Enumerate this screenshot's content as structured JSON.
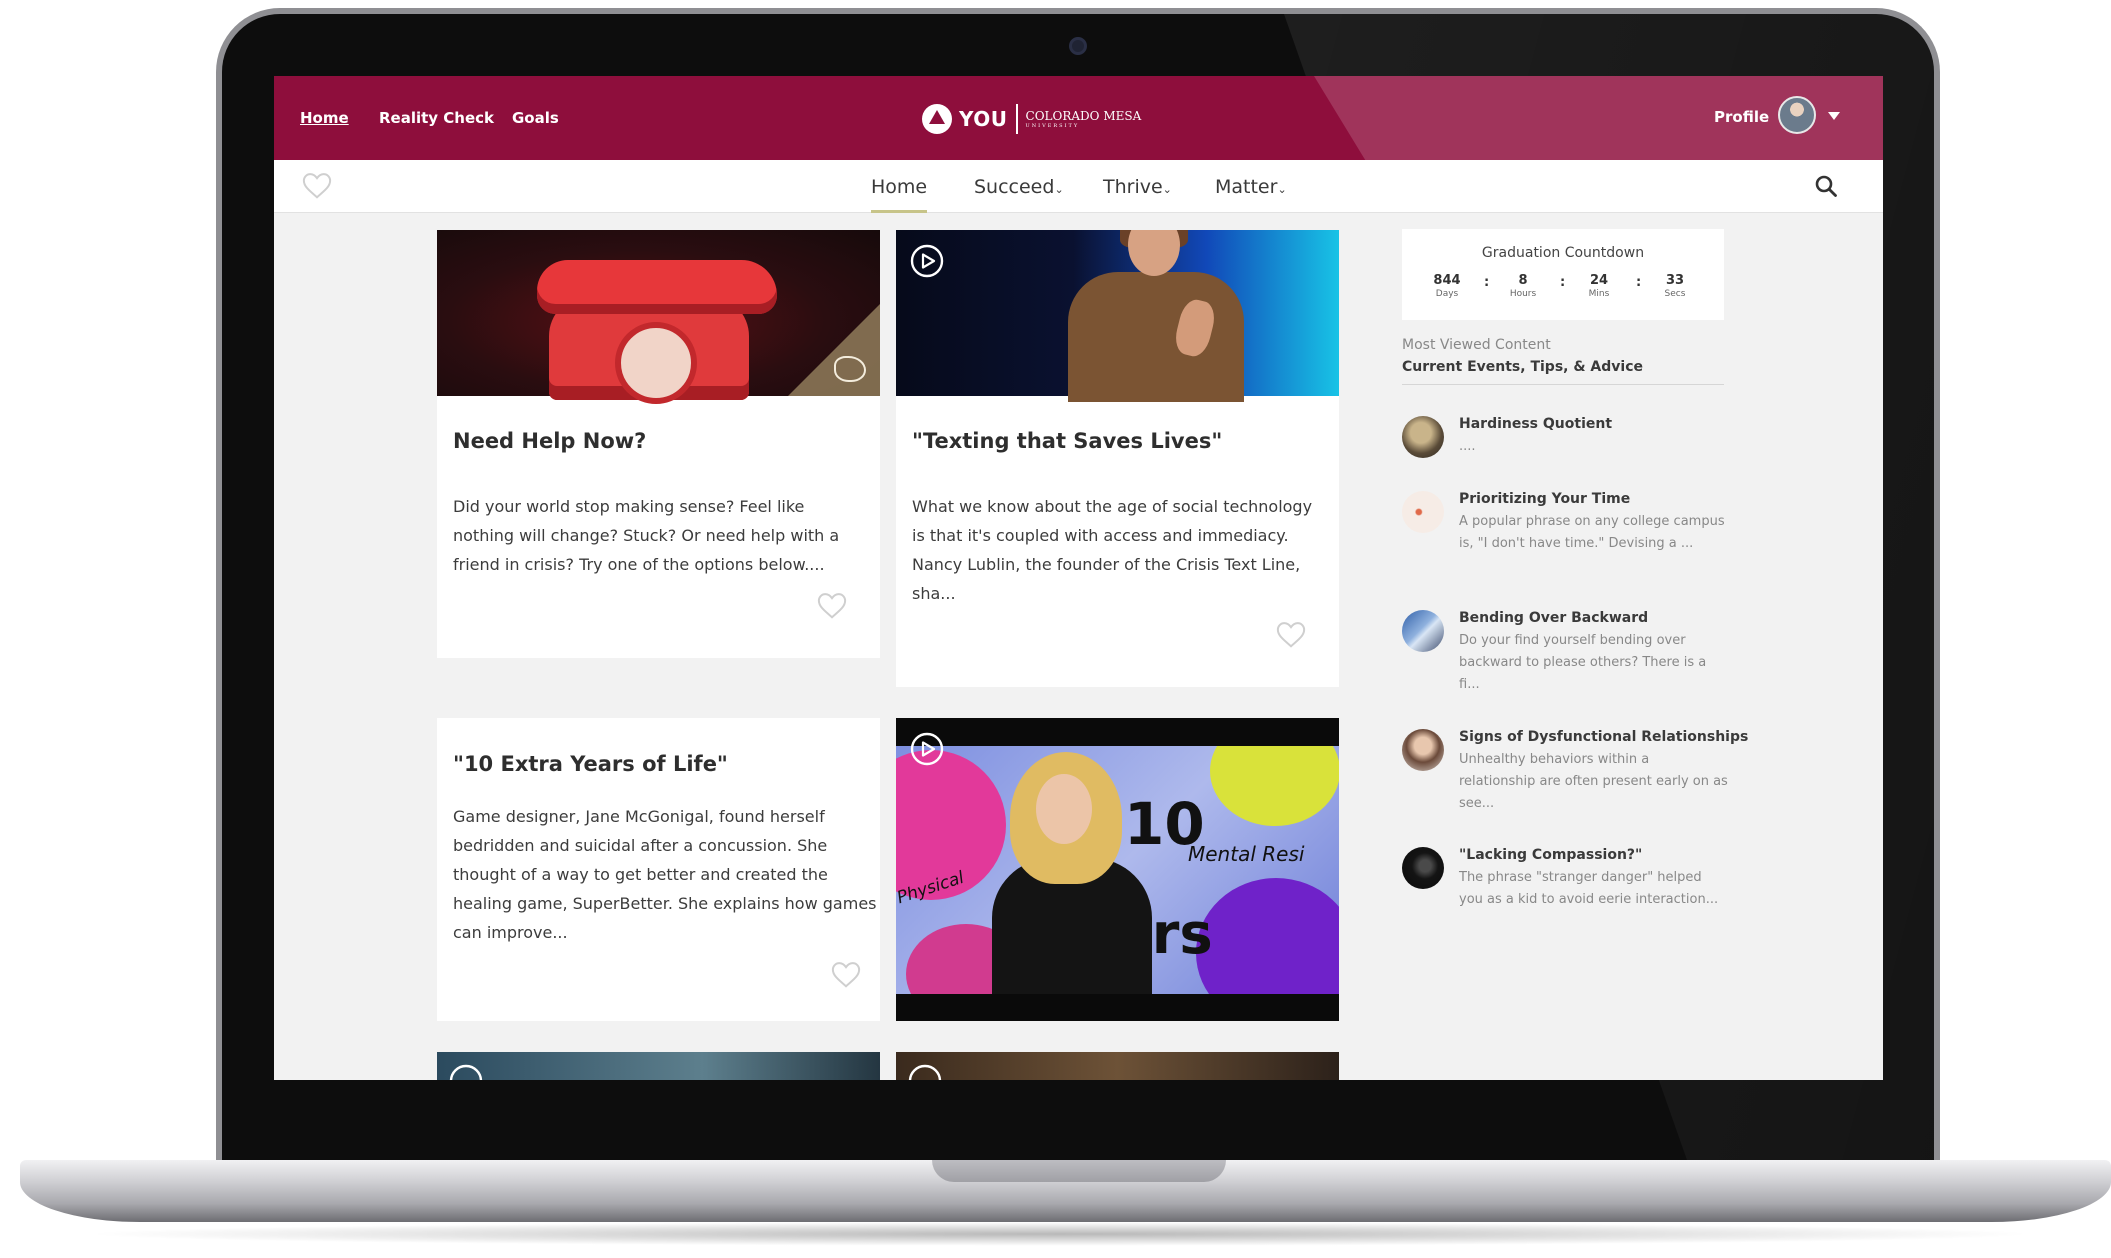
{
  "nav": {
    "links": [
      "Home",
      "Reality Check",
      "Goals"
    ],
    "brand": {
      "you": "YOU",
      "school": "COLORADO MESA",
      "school_sub": "UNIVERSITY"
    },
    "profile_label": "Profile"
  },
  "subnav": {
    "items": [
      "Home",
      "Succeed",
      "Thrive",
      "Matter"
    ],
    "active": "Home",
    "caret": "⌄"
  },
  "cards": [
    {
      "title": "Need Help Now?",
      "body": "Did your world stop making sense? Feel like nothing will change? Stuck? Or need help with a friend in crisis?   Try one of the options below...."
    },
    {
      "title": "\"Texting that Saves Lives\"",
      "body": "What we know about the age of social technology is that it's coupled with access and immediacy. Nancy Lublin, the founder of the Crisis Text Line, sha..."
    },
    {
      "title": "\"10 Extra Years of Life\"",
      "body": "Game designer, Jane McGonigal, found herself bedridden and suicidal after a concussion. She thought of a way to get better and created the healing game, SuperBetter. She explains how games can improve..."
    },
    {
      "video_text": {
        "number": "10",
        "script": "Mental Resi",
        "script_left": "Physical",
        "bottom": "ars"
      }
    }
  ],
  "countdown": {
    "title": "Graduation Countdown",
    "units": [
      {
        "value": "844",
        "label": "Days"
      },
      {
        "value": "8",
        "label": "Hours"
      },
      {
        "value": "24",
        "label": "Mins"
      },
      {
        "value": "33",
        "label": "Secs"
      }
    ],
    "separator": ":"
  },
  "most_viewed": {
    "label": "Most Viewed Content",
    "tab": "Current Events, Tips, & Advice",
    "items": [
      {
        "title": "Hardiness Quotient",
        "snippet": "...."
      },
      {
        "title": "Prioritizing Your Time",
        "snippet": "A popular phrase on any college campus is, \"I don't have time.\" Devising a ..."
      },
      {
        "title": "Bending Over Backward",
        "snippet": "Do your find yourself bending over backward to please others? There is a fi..."
      },
      {
        "title": "Signs of Dysfunctional Relationships",
        "snippet": "Unhealthy behaviors within a relationship are often present early on as see..."
      },
      {
        "title": "\"Lacking Compassion?\"",
        "snippet": "The phrase \"stranger danger\" helped you as a kid to avoid eerie interaction..."
      }
    ]
  },
  "colors": {
    "brand": "#8e0e3c",
    "active_underline": "#c7c489",
    "page_bg": "#f2f2f2"
  },
  "icons": [
    "heart-outline-icon",
    "search-icon",
    "play-circle-icon",
    "chevron-down-icon",
    "maverick-logo-icon"
  ]
}
